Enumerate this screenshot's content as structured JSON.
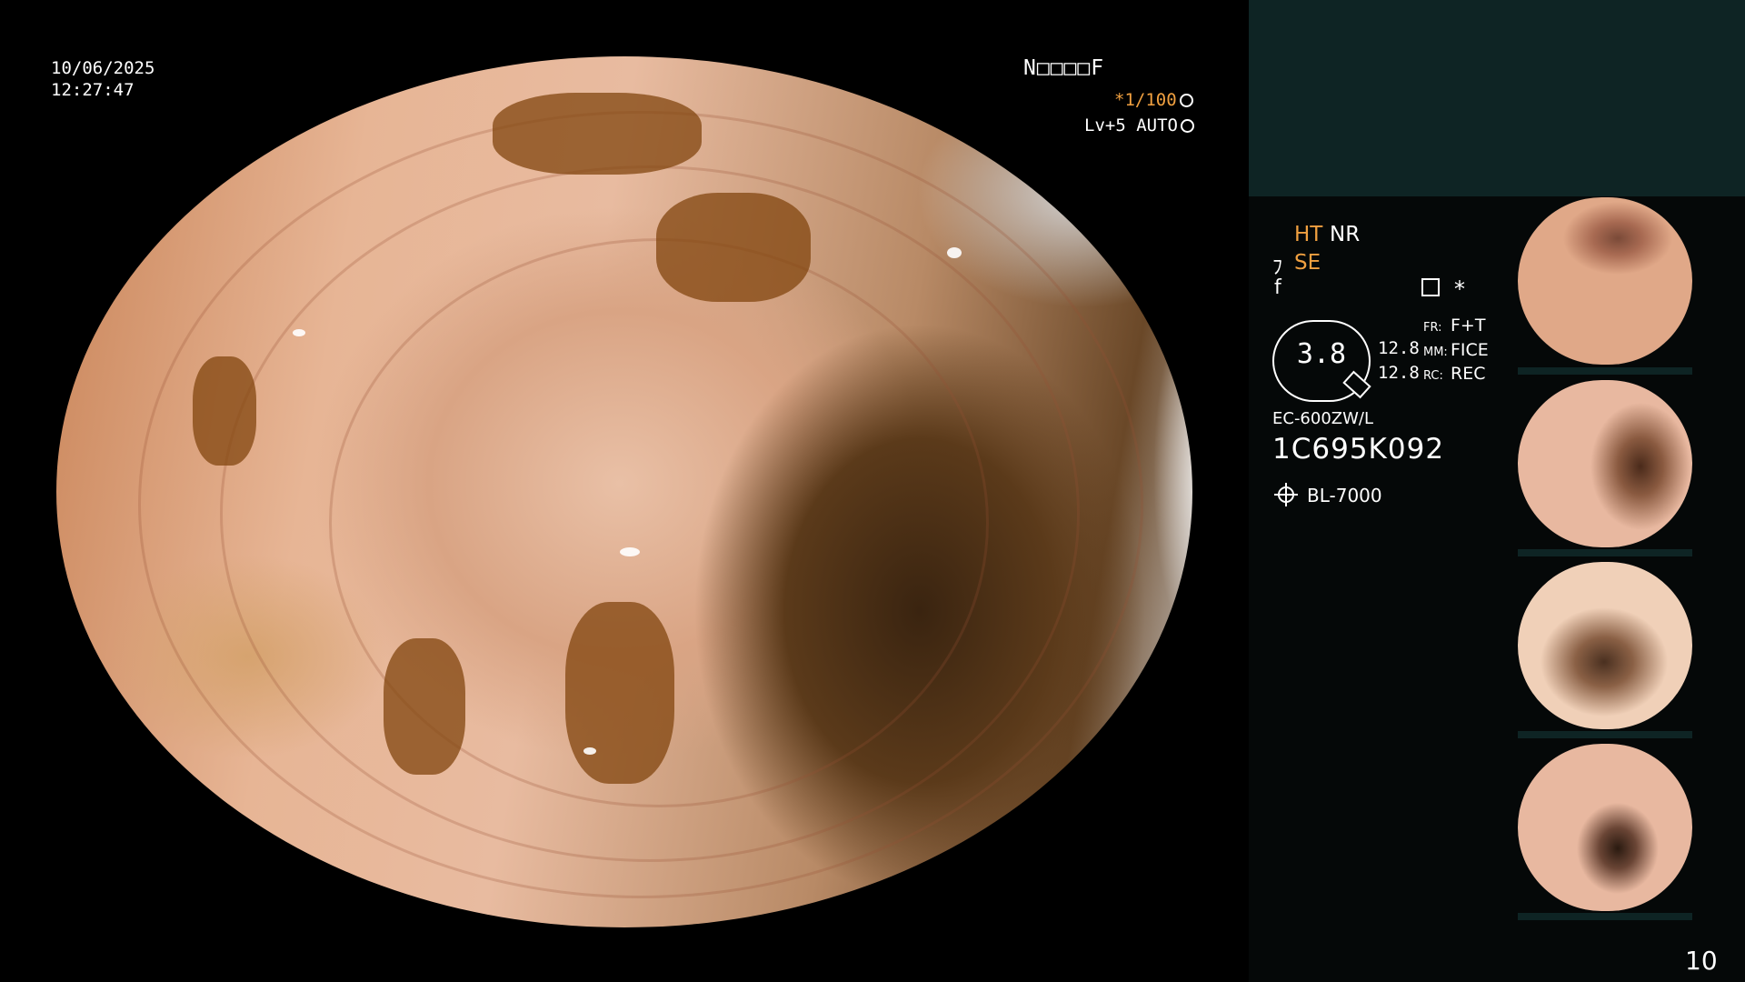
{
  "overlay": {
    "date": "10/06/2025",
    "time": "12:27:47",
    "patient_field": "N□□□□F",
    "shutter": "*1/100",
    "iris": "Lv+5 AUTO"
  },
  "side_panel": {
    "ht": "HT",
    "nr": "NR",
    "se_glyph": "ﾌ",
    "se": "SE",
    "f_glyph": "f",
    "star": "*",
    "zoom": "3.8",
    "num1": "12.8",
    "num2": "12.8",
    "fr_key": "FR:",
    "fr_val": "F+T",
    "mm_key": "MM:",
    "mm_val": "FICE",
    "rc_key": "RC:",
    "rc_val": "REC",
    "model": "EC-600ZW/L",
    "serial": "1C695K092",
    "light_source": "BL-7000"
  },
  "page_number": "10",
  "colors": {
    "accent": "#f0a040",
    "panel_header": "#0e2424",
    "panel_bg": "#050808"
  }
}
